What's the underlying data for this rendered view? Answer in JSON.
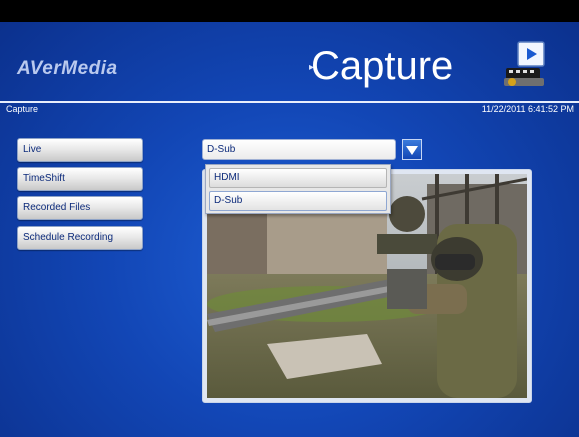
{
  "brand": {
    "logo_text": "AVerMedia"
  },
  "header": {
    "title": "Capture",
    "breadcrumb": "Capture",
    "datetime": "11/22/2011 6:41:52 PM"
  },
  "menu": {
    "items": [
      {
        "label": "Live"
      },
      {
        "label": "TimeShift"
      },
      {
        "label": "Recorded Files"
      },
      {
        "label": "Schedule Recording"
      }
    ]
  },
  "source_select": {
    "value": "D-Sub",
    "options": [
      "HDMI",
      "D-Sub"
    ]
  },
  "colors": {
    "background": "#1246b5",
    "button_text": "#0c2a7a"
  },
  "icons": [
    "film-clapper-icon",
    "dropdown-arrow-icon"
  ]
}
